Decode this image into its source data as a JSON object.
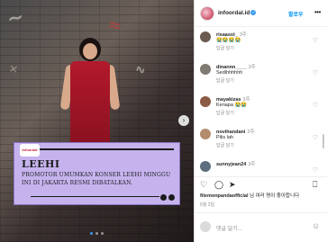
{
  "post": {
    "brand_logo": "infoordal",
    "card_title": "LEEHI",
    "card_text": "PROMOTOR UMUMKAN KONSER LEEHI MINGGU INI DI JAKARTA RESMI DIBATALKAN.",
    "card_color": "#c6b3ee",
    "carousel": {
      "slides": 3,
      "active": 0
    },
    "next_icon": "chevron-right-icon"
  },
  "header": {
    "username": "infoordal.id",
    "follow_label": "팔로우",
    "more_icon": "more-horizontal-icon"
  },
  "comments": [
    {
      "user": "risaasst_",
      "time": "3주",
      "text": "😭😭😭😭",
      "reply": "답글 달기",
      "avatar_color": "#6a5a50"
    },
    {
      "user": "dinannn____",
      "time": "3주",
      "text": "Sedihhhhhh",
      "reply": "답글 달기",
      "avatar_color": "#7f7a72"
    },
    {
      "user": "mayakizas",
      "time": "3주",
      "text": "Kenapa 😭😭",
      "reply": "답글 달기",
      "avatar_color": "#8c5a46"
    },
    {
      "user": "novihandani",
      "time": "3주",
      "text": "Pilis lah",
      "reply": "답글 달기",
      "avatar_color": "#b48c6e"
    },
    {
      "user": "sunnyjean24",
      "time": "3주",
      "text": "",
      "reply": "",
      "avatar_color": "#5e6e7e"
    }
  ],
  "actions": {
    "like_icon": "heart-icon",
    "comment_icon": "comment-icon",
    "share_icon": "send-icon",
    "save_icon": "bookmark-icon"
  },
  "likes": {
    "user": "filemonpandaofficial",
    "rest": "님 여러 명이 좋아합니다"
  },
  "date": "6월 3일",
  "add_comment": {
    "placeholder": "댓글 달기...",
    "emoji_icon": "smiley-icon"
  }
}
